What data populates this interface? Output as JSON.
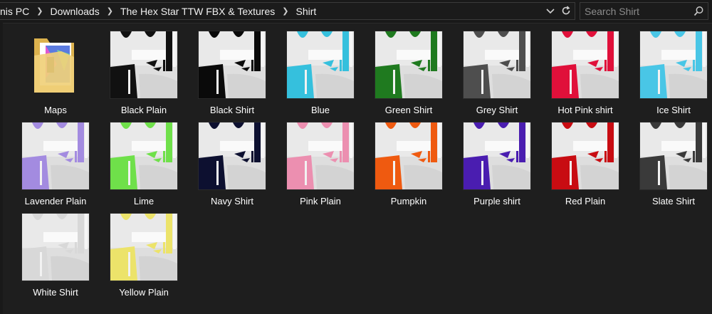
{
  "address": {
    "crumbs": [
      "nis PC",
      "Downloads",
      "The Hex Star TTW FBX & Textures",
      "Shirt"
    ],
    "icons": [
      "chevron-down-icon",
      "refresh-icon"
    ]
  },
  "search": {
    "placeholder": "Search Shirt",
    "icon": "search-icon"
  },
  "items": [
    {
      "label": "Maps",
      "type": "folder",
      "color": "#e8c25f"
    },
    {
      "label": "Black Plain",
      "color": "#111111"
    },
    {
      "label": "Black Shirt",
      "color": "#0a0a0a"
    },
    {
      "label": "Blue",
      "color": "#35c0dd"
    },
    {
      "label": "Green Shirt",
      "color": "#1f7a1f"
    },
    {
      "label": "Grey Shirt",
      "color": "#4e4e4e"
    },
    {
      "label": "Hot Pink shirt",
      "color": "#e0103a"
    },
    {
      "label": "Ice Shirt",
      "color": "#49c6e6"
    },
    {
      "label": "Lavender Plain",
      "color": "#a38be0"
    },
    {
      "label": "Lime",
      "color": "#6fe04a"
    },
    {
      "label": "Navy Shirt",
      "color": "#0d1030"
    },
    {
      "label": "Pink Plain",
      "color": "#ec8fb0"
    },
    {
      "label": "Pumpkin",
      "color": "#ef5a10"
    },
    {
      "label": "Purple shirt",
      "color": "#4a1db0"
    },
    {
      "label": "Red Plain",
      "color": "#c80c12"
    },
    {
      "label": "Slate Shirt",
      "color": "#3a3a3a"
    },
    {
      "label": "White Shirt",
      "color": "#d8d8d8"
    },
    {
      "label": "Yellow Plain",
      "color": "#ece36a"
    }
  ]
}
